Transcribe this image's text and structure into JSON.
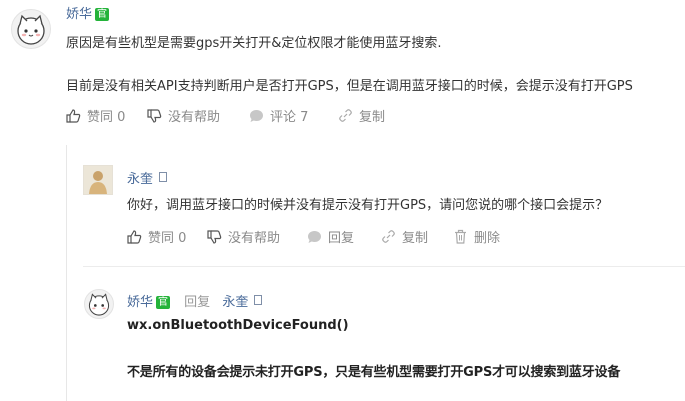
{
  "comment": {
    "author": "娇华",
    "official_badge": "官",
    "line1": "原因是有些机型是需要gps开关打开&定位权限才能使用蓝牙搜索.",
    "line2": "目前是没有相关API支持判断用户是否打开GPS，但是在调用蓝牙接口的时候，会提示没有打开GPS",
    "actions": {
      "like": "赞同 0",
      "unhelpful": "没有帮助",
      "comment": "评论 7",
      "copy": "复制"
    }
  },
  "reply1": {
    "author": "永奎",
    "text": "你好，调用蓝牙接口的时候并没有提示没有打开GPS，请问您说的哪个接口会提示？",
    "actions": {
      "like": "赞同 0",
      "unhelpful": "没有帮助",
      "reply": "回复",
      "copy": "复制",
      "delete": "删除"
    }
  },
  "reply2": {
    "author": "娇华",
    "official_badge": "官",
    "reply_word": "回复",
    "reply_to": "永奎",
    "line1": "wx.onBluetoothDeviceFound()",
    "line2": "不是所有的设备会提示未打开GPS，只是有些机型需要打开GPS才可以搜索到蓝牙设备"
  },
  "colors": {
    "name": "#4a6b9a",
    "official": "#24b33a",
    "action": "#8a8a8a"
  }
}
